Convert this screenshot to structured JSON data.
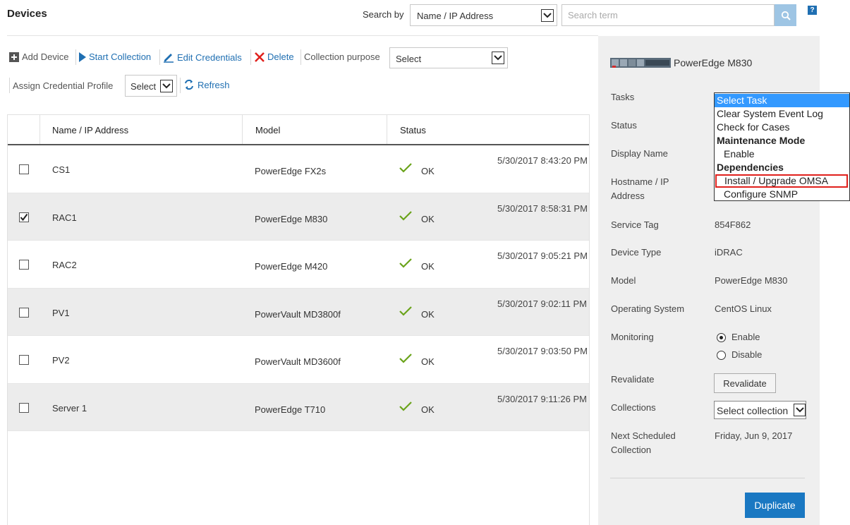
{
  "header": {
    "title": "Devices",
    "search_by_label": "Search by",
    "search_by_value": "Name / IP Address",
    "search_placeholder": "Search term",
    "help_label": "?"
  },
  "toolbar": {
    "add_device": "Add Device",
    "start_collection": "Start Collection",
    "edit_credentials": "Edit Credentials",
    "delete": "Delete",
    "collection_purpose_label": "Collection purpose",
    "collection_purpose_value": "Select",
    "assign_profile_label": "Assign Credential Profile",
    "assign_profile_value": "Select",
    "refresh": "Refresh"
  },
  "table": {
    "columns": [
      "Name / IP Address",
      "Model",
      "Status"
    ],
    "rows": [
      {
        "name": "CS1",
        "model": "PowerEdge FX2s",
        "status": "OK",
        "date": "5/30/2017 8:43:20 PM",
        "checked": false
      },
      {
        "name": "RAC1",
        "model": "PowerEdge M830",
        "status": "OK",
        "date": "5/30/2017 8:58:31 PM",
        "checked": true
      },
      {
        "name": "RAC2",
        "model": "PowerEdge M420",
        "status": "OK",
        "date": "5/30/2017 9:05:21 PM",
        "checked": false
      },
      {
        "name": "PV1",
        "model": "PowerVault MD3800f",
        "status": "OK",
        "date": "5/30/2017 9:02:11 PM",
        "checked": false
      },
      {
        "name": "PV2",
        "model": "PowerVault MD3600f",
        "status": "OK",
        "date": "5/30/2017 9:03:50 PM",
        "checked": false
      },
      {
        "name": "Server 1",
        "model": "PowerEdge T710",
        "status": "OK",
        "date": "5/30/2017 9:11:26 PM",
        "checked": false
      }
    ]
  },
  "panel": {
    "device_title": "PowerEdge M830",
    "tasks_label": "Tasks",
    "status_label": "Status",
    "display_name_label": "Display Name",
    "hostname_label_1": "Hostname / IP",
    "hostname_label_2": "Address",
    "service_tag_label": "Service Tag",
    "service_tag_value": "854F862",
    "device_type_label": "Device Type",
    "device_type_value": "iDRAC",
    "model_label": "Model",
    "model_value": "PowerEdge M830",
    "os_label": "Operating System",
    "os_value": "CentOS Linux",
    "monitoring_label": "Monitoring",
    "monitoring_enable": "Enable",
    "monitoring_disable": "Disable",
    "monitoring_selected": "Enable",
    "revalidate_label": "Revalidate",
    "revalidate_button": "Revalidate",
    "collections_label": "Collections",
    "collections_value": "Select collection",
    "next_label_1": "Next Scheduled",
    "next_label_2": "Collection",
    "next_value": "Friday, Jun 9, 2017",
    "duplicate_button": "Duplicate"
  },
  "task_dropdown": {
    "options": [
      {
        "label": "Select Task",
        "kind": "selected"
      },
      {
        "label": "Clear System Event Log",
        "kind": "option"
      },
      {
        "label": "Check for Cases",
        "kind": "option"
      },
      {
        "label": "Maintenance Mode",
        "kind": "group"
      },
      {
        "label": "Enable",
        "kind": "sub"
      },
      {
        "label": "Dependencies",
        "kind": "group"
      },
      {
        "label": "Install / Upgrade OMSA",
        "kind": "sub-highlighted"
      },
      {
        "label": "Configure SNMP",
        "kind": "sub"
      }
    ]
  },
  "colors": {
    "link": "#1f6fb2",
    "ok_check": "#6aa31a",
    "delete_x": "#e0201c",
    "selected_option": "#3399ff",
    "highlight_box": "#e0201c",
    "primary_button": "#1a78c2"
  },
  "icons": [
    "add-device-icon",
    "start-collection-icon",
    "edit-credentials-icon",
    "delete-icon",
    "refresh-icon",
    "search-icon",
    "help-icon",
    "ok-check-icon",
    "checkbox-checked-icon",
    "server-image",
    "chevron-down-icon"
  ]
}
